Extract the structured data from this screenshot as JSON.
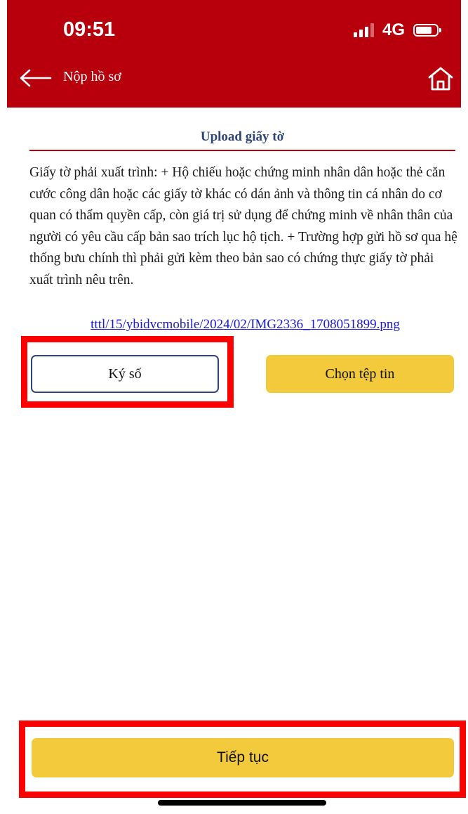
{
  "status_bar": {
    "time": "09:51",
    "network": "4G"
  },
  "header": {
    "title": "Nộp hồ sơ"
  },
  "section": {
    "title": "Upload giấy tờ"
  },
  "description": "Giấy tờ phải xuất trình: + Hộ chiếu hoặc chứng minh nhân dân hoặc thẻ căn cước công dân hoặc các giấy tờ khác có dán ảnh và thông tin cá nhân do cơ quan có thẩm quyền cấp, còn giá trị sử dụng để chứng minh về nhân thân của người có yêu cầu cấp bản sao trích lục hộ tịch. + Trường hợp gửi hồ sơ qua hệ thống bưu chính thì phải gửi kèm theo bản sao có chứng thực giấy tờ phải xuất trình nêu trên.",
  "file_link": "tttl/15/ybidvcmobile/2024/02/IMG2336_1708051899.png",
  "buttons": {
    "sign": "Ký số",
    "choose_file": "Chọn tệp tin",
    "continue": "Tiếp tục"
  },
  "colors": {
    "header_bg": "#b7000b",
    "accent_yellow": "#f3ca3b",
    "title_navy": "#2f4478",
    "highlight_red": "#ff0000"
  },
  "icons": {
    "back": "arrow-left-icon",
    "home": "home-icon",
    "signal": "signal-bars-icon",
    "battery": "battery-icon"
  }
}
